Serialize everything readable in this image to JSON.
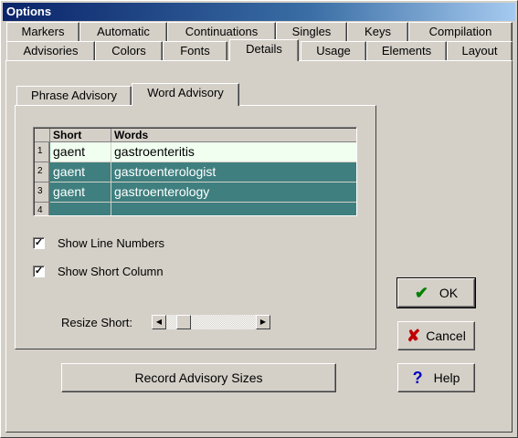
{
  "window": {
    "title": "Options"
  },
  "tabs_row1": [
    "Markers",
    "Automatic",
    "Continuations",
    "Singles",
    "Keys",
    "Compilation"
  ],
  "tabs_row2": [
    "Advisories",
    "Colors",
    "Fonts",
    "Details",
    "Usage",
    "Elements",
    "Layout"
  ],
  "active_tab": "Details",
  "subtabs": [
    "Phrase Advisory",
    "Word Advisory"
  ],
  "active_subtab": "Word Advisory",
  "grid": {
    "headers": [
      "Short",
      "Words"
    ],
    "rows": [
      {
        "num": "1",
        "short": "gaent",
        "words": "gastroenteritis"
      },
      {
        "num": "2",
        "short": "gaent",
        "words": "gastroenterologist"
      },
      {
        "num": "3",
        "short": "gaent",
        "words": "gastroenterology"
      },
      {
        "num": "4",
        "short": "",
        "words": ""
      }
    ]
  },
  "options": {
    "show_line_numbers": {
      "label": "Show Line Numbers",
      "checked": true,
      "check_mark": "✓"
    },
    "show_short_column": {
      "label": "Show Short Column",
      "checked": true,
      "check_mark": "✓"
    }
  },
  "resize_short_label": "Resize Short:",
  "buttons": {
    "record": "Record Advisory Sizes",
    "ok": "OK",
    "cancel": "Cancel",
    "help": "Help"
  },
  "colors": {
    "title_bar": "#0a246a",
    "grid_bg": "#3f7f7f",
    "ok_icon": "#008000",
    "cancel_icon": "#c00000",
    "help_icon": "#0000c0"
  }
}
